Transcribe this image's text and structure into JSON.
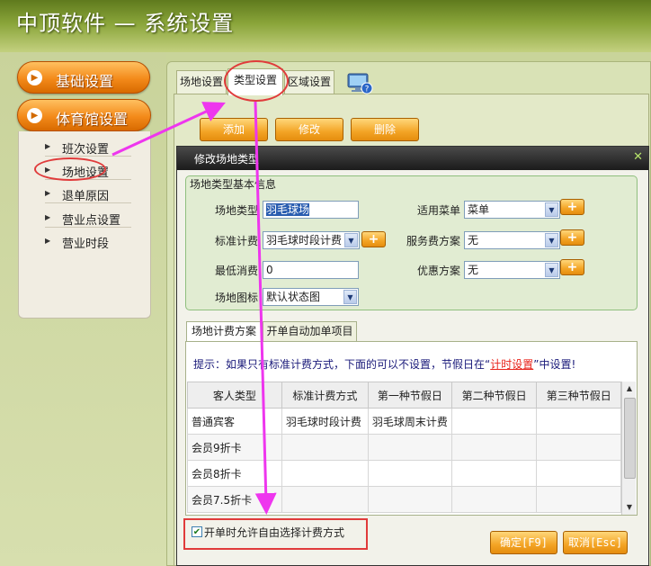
{
  "window": {
    "title": "中顶软件 — 系统设置"
  },
  "colors": {
    "accent": "#f39a1e",
    "annotation": "#e03b3b",
    "arrow": "#ee36ee"
  },
  "menu": {
    "groups": [
      {
        "label": "基础设置"
      },
      {
        "label": "体育馆设置"
      }
    ],
    "subitems": [
      {
        "label": "班次设置"
      },
      {
        "label": "场地设置",
        "selected": true
      },
      {
        "label": "退单原因"
      },
      {
        "label": "营业点设置"
      },
      {
        "label": "营业时段"
      }
    ]
  },
  "tabs": [
    {
      "label": "场地设置"
    },
    {
      "label": "类型设置",
      "active": true
    },
    {
      "label": "区域设置"
    }
  ],
  "toolbar": {
    "add": "添加",
    "edit": "修改",
    "delete": "删除"
  },
  "dialog": {
    "title": "修改场地类型",
    "group_title": "场地类型基本信息",
    "fields": {
      "type": {
        "label": "场地类型",
        "value": "羽毛球场"
      },
      "standard": {
        "label": "标准计费",
        "value": "羽毛球时段计费"
      },
      "min_charge": {
        "label": "最低消费",
        "value": "0"
      },
      "icon": {
        "label": "场地图标",
        "value": "默认状态图"
      },
      "menu": {
        "label": "适用菜单",
        "value": "菜单"
      },
      "service": {
        "label": "服务费方案",
        "value": "无"
      },
      "discount": {
        "label": "优惠方案",
        "value": "无"
      }
    },
    "plus_label": "+",
    "inner_tabs": [
      {
        "label": "场地计费方案",
        "active": true
      },
      {
        "label": "开单自动加单项目"
      }
    ],
    "hint": {
      "before": "提示：如果只有标准计费方式，下面的可以不设置，节假日在“",
      "link": "计时设置",
      "after": "”中设置!"
    },
    "table": {
      "headers": [
        "客人类型",
        "标准计费方式",
        "第一种节假日",
        "第二种节假日",
        "第三种节假日"
      ],
      "rows": [
        [
          "普通宾客",
          "羽毛球时段计费",
          "羽毛球周末计费",
          "",
          ""
        ],
        [
          "会员9折卡",
          "",
          "",
          "",
          ""
        ],
        [
          "会员8折卡",
          "",
          "",
          "",
          ""
        ],
        [
          "会员7.5折卡",
          "",
          "",
          "",
          ""
        ]
      ]
    },
    "checkbox": {
      "label": "开单时允许自由选择计费方式",
      "checked": true
    },
    "ok": "确定[F9]",
    "cancel": "取消[Esc]"
  }
}
